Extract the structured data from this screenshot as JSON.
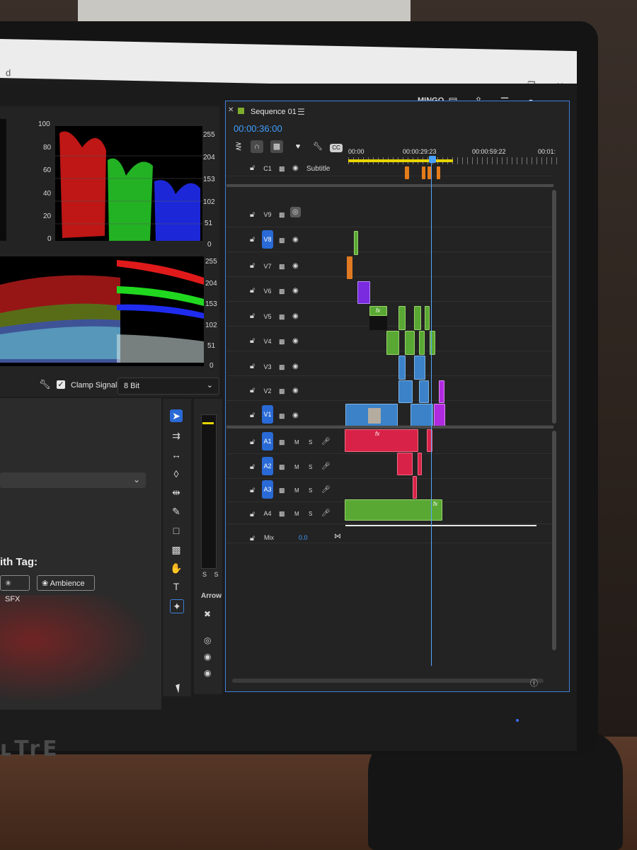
{
  "header": {
    "workspace": "MINGO",
    "icons": [
      "panel-icon",
      "share-icon",
      "menu-icon",
      "search-icon",
      "expand-icon"
    ]
  },
  "scopes": {
    "parade_scale_left": [
      "100",
      "80",
      "60",
      "40",
      "20",
      "0"
    ],
    "parade_scale_right": [
      "255",
      "204",
      "153",
      "102",
      "51",
      "0"
    ],
    "waveform_scale_right": [
      "255",
      "204",
      "153",
      "102",
      "51",
      "0"
    ],
    "clamp_signal_label": "Clamp Signal",
    "clamp_signal_checked": true,
    "bit_depth": "8 Bit"
  },
  "essential": {
    "tag_heading": "ith Tag:",
    "tags": [
      "SFX",
      "Ambience"
    ]
  },
  "tools": {
    "panel_label": "Arrow",
    "meter_solo": "S S"
  },
  "timeline": {
    "sequence_name": "Sequence 01",
    "timecode": "00:00:36:00",
    "ruler": [
      "00:00",
      "00:00:29:23",
      "00:00:59:22",
      "00:01:"
    ],
    "subtitle_track": {
      "name": "C1",
      "label": "Subtitle"
    },
    "video_tracks": [
      "V9",
      "V8",
      "V7",
      "V6",
      "V5",
      "V4",
      "V3",
      "V2",
      "V1"
    ],
    "audio_tracks": [
      "A1",
      "A2",
      "A3",
      "A4"
    ],
    "mute_label": "M",
    "solo_label": "S",
    "mix": {
      "label": "Mix",
      "value": "0.0"
    },
    "fx_label": "fx"
  },
  "monitor": {
    "brand": "ʟTrE"
  }
}
